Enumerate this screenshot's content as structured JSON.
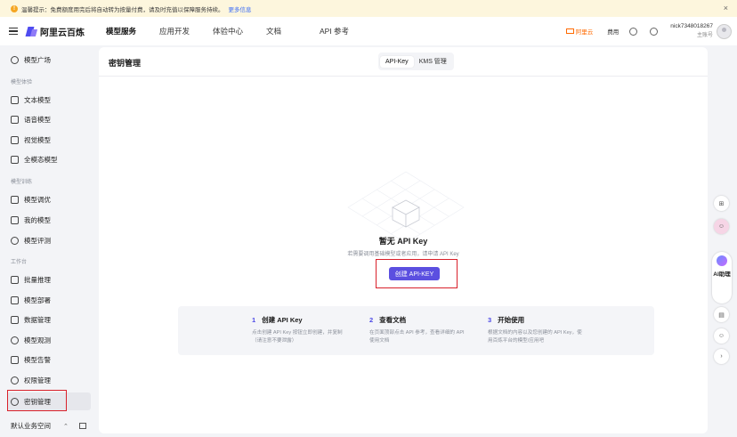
{
  "notice": {
    "text": "温馨提示：免费额度用完后将自动转为按量付费，请及时充值以保障服务持续。",
    "more": "更多信息"
  },
  "app": {
    "name": "阿里云百炼"
  },
  "nav": {
    "tabs": [
      {
        "label": "模型服务",
        "active": true
      },
      {
        "label": "应用开发"
      },
      {
        "label": "体验中心"
      },
      {
        "label": "文档"
      },
      {
        "label": "API 参考"
      }
    ]
  },
  "topbar": {
    "aliyun": "阿里云",
    "fee": "费用",
    "user_name": "nick7348018267",
    "user_role": "主账号"
  },
  "sidebar": {
    "top": {
      "label": "模型广场"
    },
    "groups": [
      {
        "title": "模型体验"
      },
      {
        "title": "模型训练"
      },
      {
        "title": "工作台"
      }
    ],
    "items": [
      {
        "label": "文本模型"
      },
      {
        "label": "语音模型"
      },
      {
        "label": "视觉模型"
      },
      {
        "label": "全模态模型"
      },
      {
        "label": "模型调优"
      },
      {
        "label": "我的模型"
      },
      {
        "label": "模型评测"
      },
      {
        "label": "批量推理"
      },
      {
        "label": "模型部署"
      },
      {
        "label": "数据管理"
      },
      {
        "label": "模型观测"
      },
      {
        "label": "模型告警"
      },
      {
        "label": "权限管理"
      },
      {
        "label": "密钥管理",
        "active": true
      }
    ],
    "workspace": "默认业务空间"
  },
  "main": {
    "title": "密钥管理",
    "tabs": [
      {
        "label": "API-Key",
        "active": true
      },
      {
        "label": "KMS 管理"
      }
    ],
    "empty_title": "暂无 API Key",
    "empty_desc": "若需要调用基础模型或者应用，请申请 API Key",
    "create_button": "创建 API-KEY",
    "steps": [
      {
        "num": "1",
        "title": "创建 API Key",
        "desc": "点击创建 API Key 按钮立即创建，并复制（请注意不要泄露）"
      },
      {
        "num": "2",
        "title": "查看文档",
        "desc": "在页面顶部点击 API 参考，查看详细的 API 使用文档"
      },
      {
        "num": "3",
        "title": "开始使用",
        "desc": "根据文档的内容以及您创建的 API Key，使用百炼平台的模型/应用吧"
      }
    ]
  },
  "rail": {
    "ai_label": "AI助理"
  },
  "colors": {
    "accent": "#5b4fe0",
    "highlight": "#d9202a",
    "notice_bg": "#fdf6dd"
  }
}
